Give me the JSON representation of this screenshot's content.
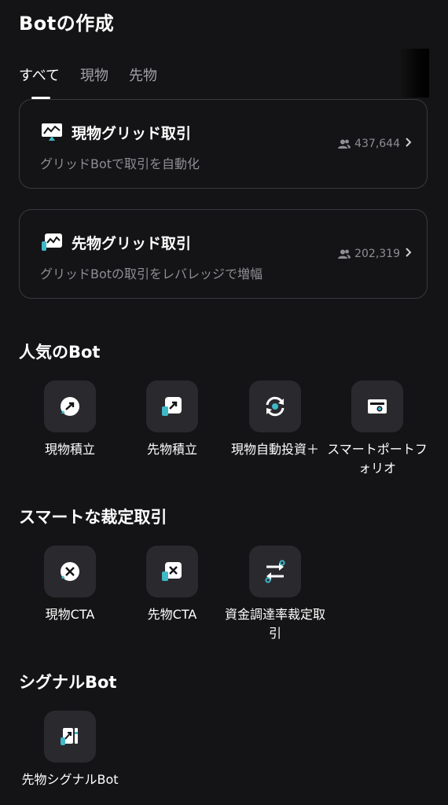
{
  "page": {
    "title": "Botの作成"
  },
  "tabs": [
    {
      "label": "すべて",
      "active": true
    },
    {
      "label": "現物",
      "active": false
    },
    {
      "label": "先物",
      "active": false
    }
  ],
  "cards": [
    {
      "title": "現物グリッド取引",
      "subtitle": "グリッドBotで取引を自動化",
      "count": "437,644",
      "icon": "spot-grid-icon"
    },
    {
      "title": "先物グリッド取引",
      "subtitle": "グリッドBotの取引をレバレッジで増幅",
      "count": "202,319",
      "icon": "futures-grid-icon"
    }
  ],
  "sections": {
    "popular": {
      "title": "人気のBot",
      "items": [
        {
          "label": "現物積立",
          "icon": "spot-dca-icon"
        },
        {
          "label": "先物積立",
          "icon": "futures-dca-icon"
        },
        {
          "label": "現物自動投資＋",
          "icon": "auto-invest-icon"
        },
        {
          "label": "スマートポートフォリオ",
          "icon": "smart-portfolio-icon"
        }
      ]
    },
    "arbitrage": {
      "title": "スマートな裁定取引",
      "items": [
        {
          "label": "現物CTA",
          "icon": "spot-cta-icon"
        },
        {
          "label": "先物CTA",
          "icon": "futures-cta-icon"
        },
        {
          "label": "資金調達率裁定取引",
          "icon": "funding-rate-arbitrage-icon"
        }
      ]
    },
    "signal": {
      "title": "シグナルBot",
      "items": [
        {
          "label": "先物シグナルBot",
          "icon": "futures-signal-icon"
        }
      ]
    }
  },
  "colors": {
    "accent": "#3fb8c8",
    "background": "#141416",
    "card_border": "#3a3a3e",
    "icon_box": "#2a2a2e"
  }
}
